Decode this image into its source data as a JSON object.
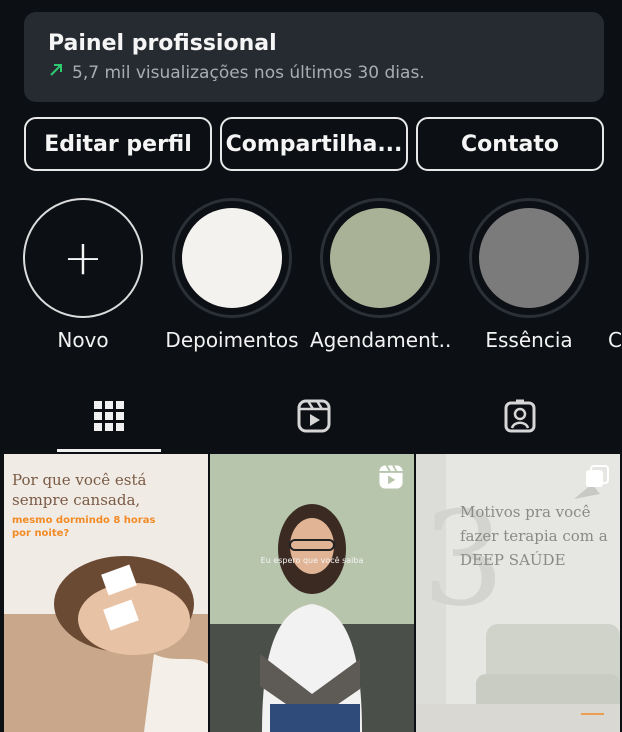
{
  "panel": {
    "title": "Painel profissional",
    "subtitle": "5,7 mil visualizações nos últimos 30 dias.",
    "trend_icon": "trend-up-icon",
    "trend_color": "#2ecc71"
  },
  "buttons": {
    "edit": "Editar perfil",
    "share": "Compartilha...",
    "contact": "Contato"
  },
  "highlights": [
    {
      "label": "Novo",
      "color": "",
      "icon": "plus-icon"
    },
    {
      "label": "Depoimentos",
      "color": "#f4f2ef"
    },
    {
      "label": "Agendament...",
      "color": "#a9b296"
    },
    {
      "label": "Essência",
      "color": "#7b7b7b"
    },
    {
      "label": "C",
      "color": ""
    }
  ],
  "tabs": [
    {
      "name": "grid-tab",
      "icon": "grid-icon",
      "active": true
    },
    {
      "name": "reels-tab",
      "icon": "reels-icon",
      "active": false
    },
    {
      "name": "tagged-tab",
      "icon": "tagged-person-icon",
      "active": false
    }
  ],
  "posts": [
    {
      "title": "Por que você está sempre cansada,",
      "subtitle": "mesmo dormindo 8 horas por noite?",
      "type": "image"
    },
    {
      "title": "Eu espero que você saiba",
      "type": "reel",
      "icon": "reels-icon"
    },
    {
      "title": "Motivos pra você fazer terapia com a DEEP SAÚDE",
      "type": "carousel",
      "icon": "carousel-icon"
    }
  ]
}
